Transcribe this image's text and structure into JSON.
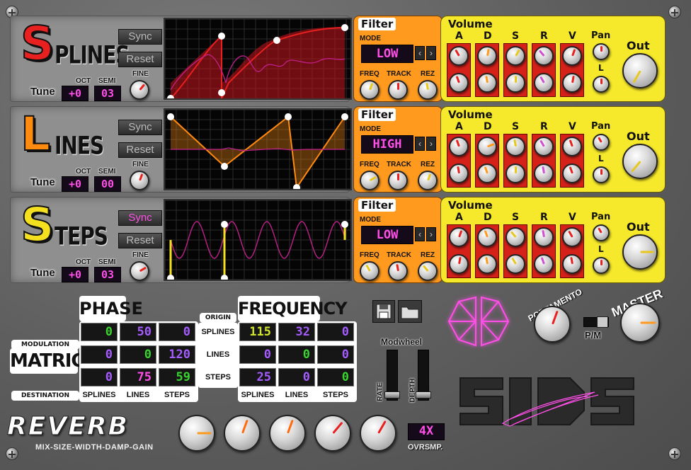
{
  "oscillators": [
    {
      "initial": "S",
      "rest": "PLINES",
      "initial_color": "#e8201f",
      "sync_label": "Sync",
      "reset_label": "Reset",
      "sync_active": false,
      "oct_label": "OCT",
      "semi_label": "SEMI",
      "tune_label": "Tune",
      "fine_label": "FINE",
      "oct_value": "+0",
      "semi_value": "03",
      "filter": {
        "title": "Filter",
        "mode_label": "MODE",
        "mode_value": "LOW",
        "freq_label": "FREQ",
        "track_label": "TRACK",
        "rez_label": "REZ"
      },
      "volume": {
        "title": "Volume",
        "a": "A",
        "d": "D",
        "s": "S",
        "r": "R",
        "v": "V",
        "pan": "Pan",
        "l": "L",
        "out": "Out"
      }
    },
    {
      "initial": "L",
      "rest": "INES",
      "initial_color": "#ff8a10",
      "sync_label": "Sync",
      "reset_label": "Reset",
      "sync_active": false,
      "oct_label": "OCT",
      "semi_label": "SEMI",
      "tune_label": "Tune",
      "fine_label": "FINE",
      "oct_value": "+0",
      "semi_value": "00",
      "filter": {
        "title": "Filter",
        "mode_label": "MODE",
        "mode_value": "HIGH",
        "freq_label": "FREQ",
        "track_label": "TRACK",
        "rez_label": "REZ"
      },
      "volume": {
        "title": "Volume",
        "a": "A",
        "d": "D",
        "s": "S",
        "r": "R",
        "v": "V",
        "pan": "Pan",
        "l": "L",
        "out": "Out"
      }
    },
    {
      "initial": "S",
      "rest": "TEPS",
      "initial_color": "#f4e01e",
      "sync_label": "Sync",
      "reset_label": "Reset",
      "sync_active": true,
      "oct_label": "OCT",
      "semi_label": "SEMI",
      "tune_label": "Tune",
      "fine_label": "FINE",
      "oct_value": "+0",
      "semi_value": "03",
      "filter": {
        "title": "Filter",
        "mode_label": "MODE",
        "mode_value": "LOW",
        "freq_label": "FREQ",
        "track_label": "TRACK",
        "rez_label": "REZ"
      },
      "volume": {
        "title": "Volume",
        "a": "A",
        "d": "D",
        "s": "S",
        "r": "R",
        "v": "V",
        "pan": "Pan",
        "l": "L",
        "out": "Out"
      }
    }
  ],
  "matrices": {
    "modulation_label": "MODULATION",
    "matrices_label": "MATRICES",
    "destination_label": "DESTINATION",
    "origin_label": "ORIGIN",
    "phase": {
      "title": "PHASE",
      "cells": [
        [
          "0",
          "50",
          "0"
        ],
        [
          "0",
          "0",
          "120"
        ],
        [
          "0",
          "75",
          "59"
        ]
      ],
      "cell_colors": [
        [
          "#39d42f",
          "#a45cff",
          "#a45cff"
        ],
        [
          "#a45cff",
          "#39d42f",
          "#a45cff"
        ],
        [
          "#a45cff",
          "#ff4fe8",
          "#39d42f"
        ]
      ]
    },
    "frequency": {
      "title": "FREQUENCY",
      "cells": [
        [
          "115",
          "32",
          "0"
        ],
        [
          "0",
          "0",
          "0"
        ],
        [
          "25",
          "0",
          "0"
        ]
      ],
      "cell_colors": [
        [
          "#cfe52a",
          "#a45cff",
          "#a45cff"
        ],
        [
          "#a45cff",
          "#39d42f",
          "#a45cff"
        ],
        [
          "#a45cff",
          "#a45cff",
          "#39d42f"
        ]
      ]
    },
    "rows": [
      "SPLINES",
      "LINES",
      "STEPS"
    ],
    "cols": [
      "SPLINES",
      "LINES",
      "STEPS"
    ]
  },
  "modwheel": {
    "title": "Modwheel",
    "rate_label": "RATE",
    "depth_label": "DEPTH"
  },
  "portamento": {
    "label": "PORTAMENTO",
    "pm_label": "P/M"
  },
  "master": {
    "label": "MASTER"
  },
  "reverb": {
    "title": "REVERB",
    "subtitle": "MIX-SIZE-WIDTH-DAMP-GAIN",
    "oversample_value": "4X",
    "oversample_label": "OVRSMP."
  },
  "colors": {
    "accent_pink": "#ff4fe8",
    "orange": "#ff9a1f",
    "yellow": "#f6e82a",
    "red": "#d4221b"
  },
  "icons": {
    "save": "floppy-disk-icon",
    "open": "folder-icon",
    "logo": "sides-logo"
  }
}
